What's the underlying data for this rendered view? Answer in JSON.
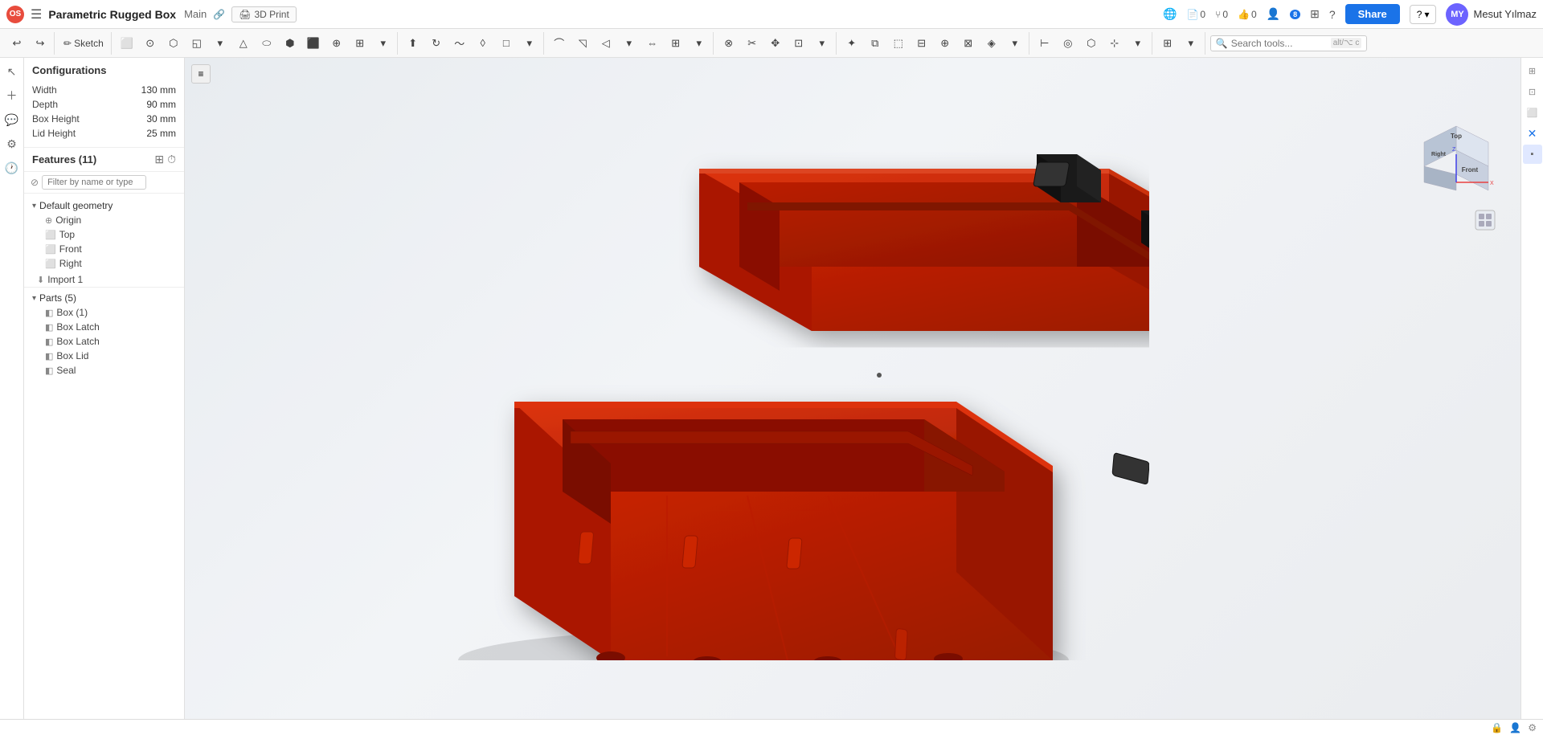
{
  "app": {
    "logo_text": "OS",
    "doc_title": "Parametric Rugged Box",
    "doc_tab": "Main",
    "print_label": "3D Print",
    "counters": {
      "files": "0",
      "branches": "0",
      "likes": "0"
    },
    "share_label": "Share",
    "help_label": "?",
    "user_name": "Mesut Yılmaz",
    "user_initials": "MY",
    "notification_count": "8"
  },
  "toolbar": {
    "sketch_label": "Sketch",
    "search_placeholder": "Search tools...",
    "search_shortcut": "alt/⌥ c"
  },
  "config": {
    "title": "Configurations",
    "params": [
      {
        "label": "Width",
        "value": "130 mm"
      },
      {
        "label": "Depth",
        "value": "90 mm"
      },
      {
        "label": "Box Height",
        "value": "30 mm"
      },
      {
        "label": "Lid Height",
        "value": "25 mm"
      }
    ]
  },
  "features": {
    "title": "Features (11)",
    "filter_placeholder": "Filter by name or type",
    "default_geometry_label": "Default geometry",
    "origin_label": "Origin",
    "top_label": "Top",
    "front_label": "Front",
    "right_label": "Right",
    "import1_label": "Import 1",
    "parts_title": "Parts (5)",
    "parts": [
      {
        "label": "Box (1)"
      },
      {
        "label": "Box Latch"
      },
      {
        "label": "Box Latch"
      },
      {
        "label": "Box Lid"
      },
      {
        "label": "Seal"
      }
    ]
  },
  "orient_cube": {
    "top_label": "Top",
    "front_label": "Front",
    "right_label": "Right"
  },
  "bottom": {
    "icons": [
      "lock-icon",
      "unlock-icon",
      "settings-icon"
    ]
  }
}
